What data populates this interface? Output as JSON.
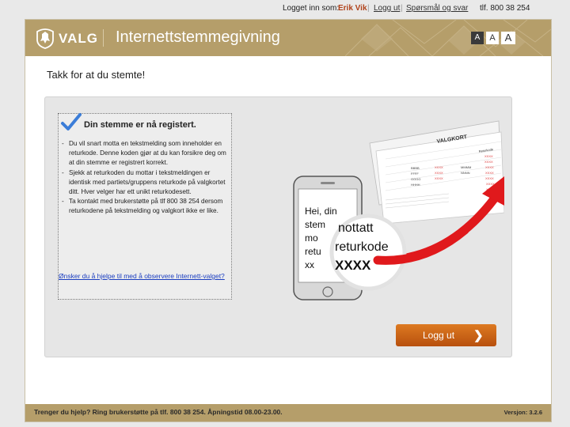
{
  "topbar": {
    "logged_in_as": "Logget inn som:",
    "user_name": "Erik Vik",
    "logout_link": "Logg ut",
    "sep": "|",
    "faq_link": "Spørsmål og svar",
    "phone": "tlf. 800 38 254"
  },
  "header": {
    "brand": "VALG",
    "title": "Internettstemmegivning",
    "font_sizes": [
      "A",
      "A",
      "A"
    ]
  },
  "main": {
    "thanks": "Takk for at du stemte!",
    "info": {
      "title": "Din stemme er nå registert.",
      "bullets": [
        "Du vil snart motta en tekstmelding som inneholder en returkode. Denne koden gjør at du kan forsikre deg om at din stemme er registrert korrekt.",
        "Sjekk at returkoden du mottar i tekstmeldingen er identisk med partiets/gruppens returkode på valgkortet ditt. Hver velger har ett unikt returkodesett.",
        "Ta kontakt med brukerstøtte på tlf 800 38 254 dersom returkodene på tekstmelding og valgkort ikke er like."
      ],
      "observe_link": "Ønsker du å hjelpe til med å observere Internett-valget?"
    },
    "illustration": {
      "card_title": "VALGKORT",
      "card_codes_header": "Returkode",
      "card_row_codes": [
        "XXXX",
        "XXXX",
        "XXXX",
        "XXXX",
        "XXXX",
        "XXXX",
        "XXXX",
        "XXXX"
      ],
      "card_row_names": [
        "BBBB",
        "FFFF",
        "GGGG",
        "HHHH"
      ],
      "card_mid_codes": [
        "XXXX",
        "XXXX",
        "MMMM",
        "NNNN",
        "XXXX"
      ],
      "phone_line1": "Hei, din",
      "phone_line2": "stem",
      "phone_line3": "mo",
      "phone_line4": "retu",
      "phone_line5": "xx",
      "magnifier_line1": "nottatt",
      "magnifier_line2": "returkode",
      "magnifier_line3": "XXXX"
    },
    "logout_button": "Logg ut",
    "logout_arrow": "❯"
  },
  "footer": {
    "help": "Trenger du hjelp? Ring brukerstøtte på tlf. 800 38 254. Åpningstid 08.00-23.00.",
    "version": "Versjon: 3.2.6"
  },
  "colors": {
    "header_gold": "#b59e6a",
    "accent_orange": "#cc6618",
    "user_red": "#b0421a",
    "arrow_red": "#e0191c",
    "link_blue": "#1a3dc0"
  }
}
